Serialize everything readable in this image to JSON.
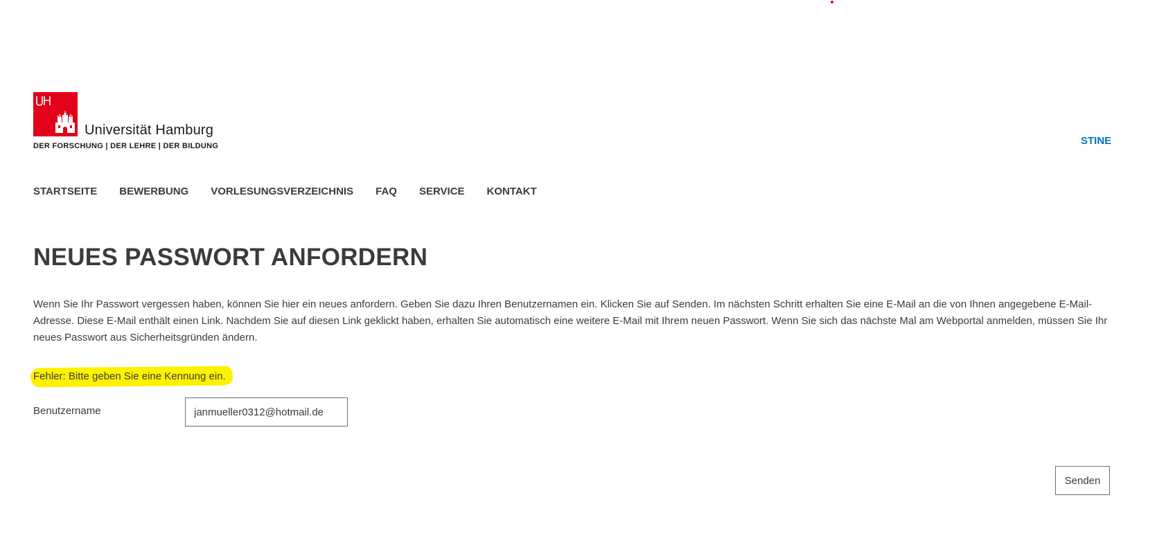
{
  "brand": {
    "logo_mark": "UHH",
    "name": "Universität Hamburg",
    "tagline": "DER FORSCHUNG | DER LEHRE | DER BILDUNG",
    "accent_color": "#e2001a"
  },
  "header": {
    "stine_link": "STINE",
    "link_color": "#0271bb"
  },
  "nav": {
    "items": [
      {
        "label": "STARTSEITE"
      },
      {
        "label": "BEWERBUNG"
      },
      {
        "label": "VORLESUNGSVERZEICHNIS"
      },
      {
        "label": "FAQ"
      },
      {
        "label": "SERVICE"
      },
      {
        "label": "KONTAKT"
      }
    ]
  },
  "main": {
    "title": "NEUES PASSWORT ANFORDERN",
    "intro": "Wenn Sie Ihr Passwort vergessen haben, können Sie hier ein neues anfordern. Geben Sie dazu Ihren Benutzernamen ein. Klicken Sie auf Senden. Im nächsten Schritt erhalten Sie eine E-Mail an die von Ihnen angegebene E-Mail-Adresse. Diese E-Mail enthält einen Link. Nachdem Sie auf diesen Link geklickt haben, erhalten Sie automatisch eine weitere E-Mail mit Ihrem neuen Passwort. Wenn Sie sich das nächste Mal am Webportal anmelden, müssen Sie Ihr neues Passwort aus Sicherheitsgründen ändern.",
    "error": "Fehler: Bitte geben Sie eine Kennung ein.",
    "highlight_color": "#fff200"
  },
  "form": {
    "username_label": "Benutzername",
    "username_value": "janmueller0312@hotmail.de",
    "submit_label": "Senden"
  }
}
